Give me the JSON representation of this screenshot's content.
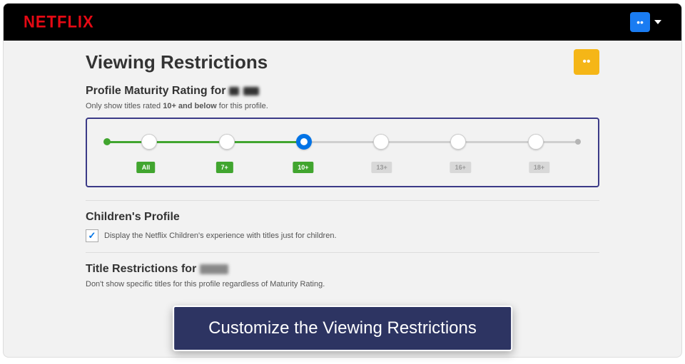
{
  "brand": "NETFLIX",
  "page_title": "Viewing Restrictions",
  "maturity": {
    "heading_prefix": "Profile Maturity Rating for",
    "sub_prefix": "Only show titles rated ",
    "sub_bold": "10+ and below",
    "sub_suffix": " for this profile.",
    "ratings": [
      "All",
      "7+",
      "10+",
      "13+",
      "16+",
      "18+"
    ],
    "selected_index": 2
  },
  "children": {
    "heading": "Children's Profile",
    "checkbox_label": "Display the Netflix Children's experience with titles just for children.",
    "checked": true
  },
  "title_restrictions": {
    "heading_prefix": "Title Restrictions for",
    "sub": "Don't show specific titles for this profile regardless of Maturity Rating."
  },
  "callout": "Customize the Viewing Restrictions"
}
